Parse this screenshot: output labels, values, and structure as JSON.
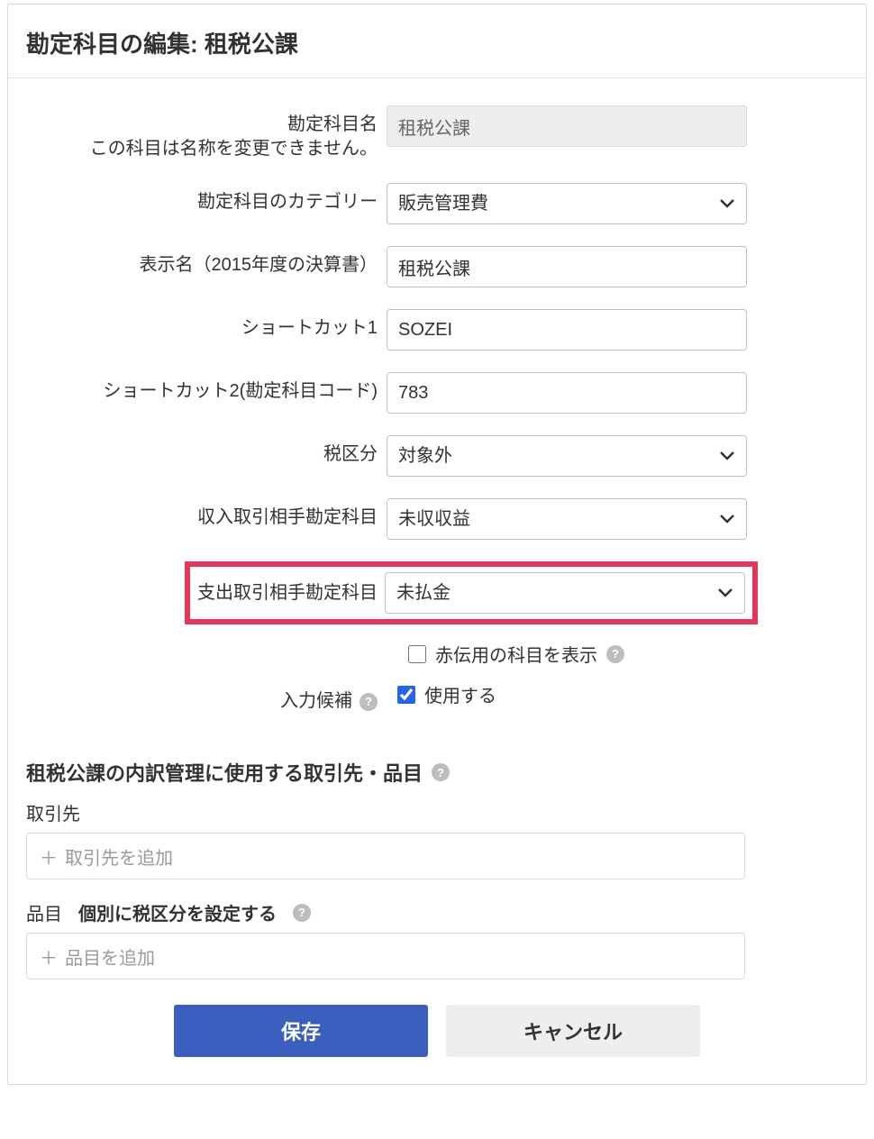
{
  "header": {
    "title": "勘定科目の編集: 租税公課"
  },
  "form": {
    "account_name": {
      "label": "勘定科目名",
      "note": "この科目は名称を変更できません。",
      "value": "租税公課"
    },
    "category": {
      "label": "勘定科目のカテゴリー",
      "value": "販売管理費"
    },
    "display_name": {
      "label": "表示名（2015年度の決算書）",
      "value": "租税公課"
    },
    "shortcut1": {
      "label": "ショートカット1",
      "value": "SOZEI"
    },
    "shortcut2": {
      "label": "ショートカット2(勘定科目コード)",
      "value": "783"
    },
    "tax_type": {
      "label": "税区分",
      "value": "対象外"
    },
    "income_account": {
      "label": "収入取引相手勘定科目",
      "value": "未収収益"
    },
    "expense_account": {
      "label": "支出取引相手勘定科目",
      "value": "未払金"
    },
    "show_reversal": {
      "label": "赤伝用の科目を表示",
      "checked": false
    },
    "input_suggest": {
      "label": "入力候補",
      "checkbox_label": "使用する",
      "checked": true
    }
  },
  "breakdown": {
    "heading": "租税公課の内訳管理に使用する取引先・品目",
    "partner_label": "取引先",
    "partner_add": "取引先を追加",
    "item_label": "品目",
    "item_tax_label": "個別に税区分を設定する",
    "item_add": "品目を追加"
  },
  "buttons": {
    "save": "保存",
    "cancel": "キャンセル"
  },
  "glyphs": {
    "plus": "＋",
    "question": "?"
  }
}
